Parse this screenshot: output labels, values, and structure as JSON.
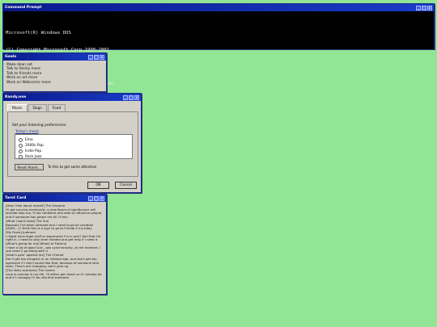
{
  "cmd": {
    "title": "Command Prompt",
    "lines": [
      "Microsoft(R) Windows DOS",
      "(C) Copyright Microsoft Corp 1990-2001.",
      "",
      "C:\\WINDOWS\\SYSTEM32> Start MARGOAL3.html"
    ]
  },
  "goals": {
    "title": "Goals",
    "items": [
      "Make dean set",
      "Talk to family more",
      "Talk to friends more",
      "Work on art more",
      "Work on Webcomic more"
    ]
  },
  "randy": {
    "title": "Randy.exe",
    "tabs": [
      "Music",
      "Dogs",
      "Food"
    ],
    "prompt": "Set your listening preferences:",
    "group_label": "Today's mood",
    "options": [
      "Emo",
      "2000s Pop",
      "Indie Pop",
      "Rock Jazz"
    ],
    "reset_label": "Reset Alarm...",
    "reset_hint": "To this to get some attention",
    "ok_label": "OK",
    "cancel_label": "Cancel"
  },
  "tarot": {
    "title": "Tarot Card",
    "lines": [
      "[How I feel about myself] The Emperor",
      "I'll get success eventually, a new figure of significance will",
      "provide help me, I'll be confident and able to influence people,",
      "and if someone has grown me till I'll win.",
      "[What I want most] The Sun",
      "Basically I've been stressed and I need to go on vacation",
      "[DURL...] I think this is a sign to go to Florida 4 my bday",
      "[My Fears] Judment",
      "I might have legal stuff or arguments I'm in and I feel that I'm",
      "right in. I need to stay level headed and get help if I need it",
      "[What's going for me] Wheel of Fortune",
      "I have a lot of good luck - aka synchronicity, at the moment. I",
      "just need 2 go along with it",
      "[what's goin' against me] The Chariot",
      "Don't get too arrogant or an inflated ego, and don't get too",
      "agressive if I don't sound like that, because of someone who",
      "does. Time's are changing, don't give up.",
      "[The likely outcome] The Lovers",
      "Love is coming in my life, I'll either get closer or if I already do",
      "and if I unhappy I'll be into find someone."
    ]
  },
  "buttons": {
    "minimize": "_",
    "maximize": "□",
    "close": "x"
  }
}
